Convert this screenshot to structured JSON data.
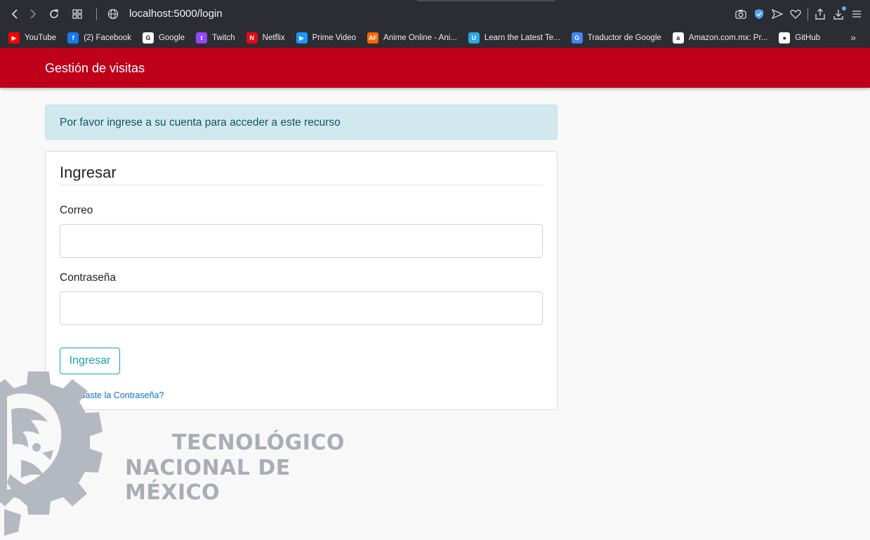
{
  "browser": {
    "url": "localhost:5000/login",
    "bookmarks": [
      {
        "label": "YouTube",
        "icon": "youtube-icon",
        "color": "#ff0000",
        "glyph": "▶"
      },
      {
        "label": "(2) Facebook",
        "icon": "facebook-icon",
        "color": "#1877f2",
        "glyph": "f"
      },
      {
        "label": "Google",
        "icon": "google-icon",
        "color": "#ffffff",
        "glyph": "G"
      },
      {
        "label": "Twitch",
        "icon": "twitch-icon",
        "color": "#9146ff",
        "glyph": "t"
      },
      {
        "label": "Netflix",
        "icon": "netflix-icon",
        "color": "#e50914",
        "glyph": "N"
      },
      {
        "label": "Prime Video",
        "icon": "prime-video-icon",
        "color": "#1a98ff",
        "glyph": "▶"
      },
      {
        "label": "Anime Online - Ani...",
        "icon": "animeflv-icon",
        "color": "#ff6600",
        "glyph": "AF"
      },
      {
        "label": "Learn the Latest Te...",
        "icon": "udemy-icon",
        "color": "#2aa8e0",
        "glyph": "U"
      },
      {
        "label": "Traductor de Google",
        "icon": "google-translate-icon",
        "color": "#4285f4",
        "glyph": "G"
      },
      {
        "label": "Amazon.com.mx: Pr...",
        "icon": "amazon-icon",
        "color": "#ffffff",
        "glyph": "a"
      },
      {
        "label": "GitHub",
        "icon": "github-icon",
        "color": "#ffffff",
        "glyph": "●"
      }
    ]
  },
  "header": {
    "title": "Gestión de visitas",
    "color": "#be001a"
  },
  "alert": {
    "message": "Por favor ingrese a su cuenta para acceder a este recurso"
  },
  "login": {
    "title": "Ingresar",
    "email_label": "Correo",
    "email_value": "",
    "password_label": "Contraseña",
    "password_value": "",
    "submit_label": "Ingresar",
    "forgot_label": "Olvidaste la Contraseña?"
  },
  "logo": {
    "line1": "TECNOLÓGICO",
    "line2": "NACIONAL DE MÉXICO"
  }
}
